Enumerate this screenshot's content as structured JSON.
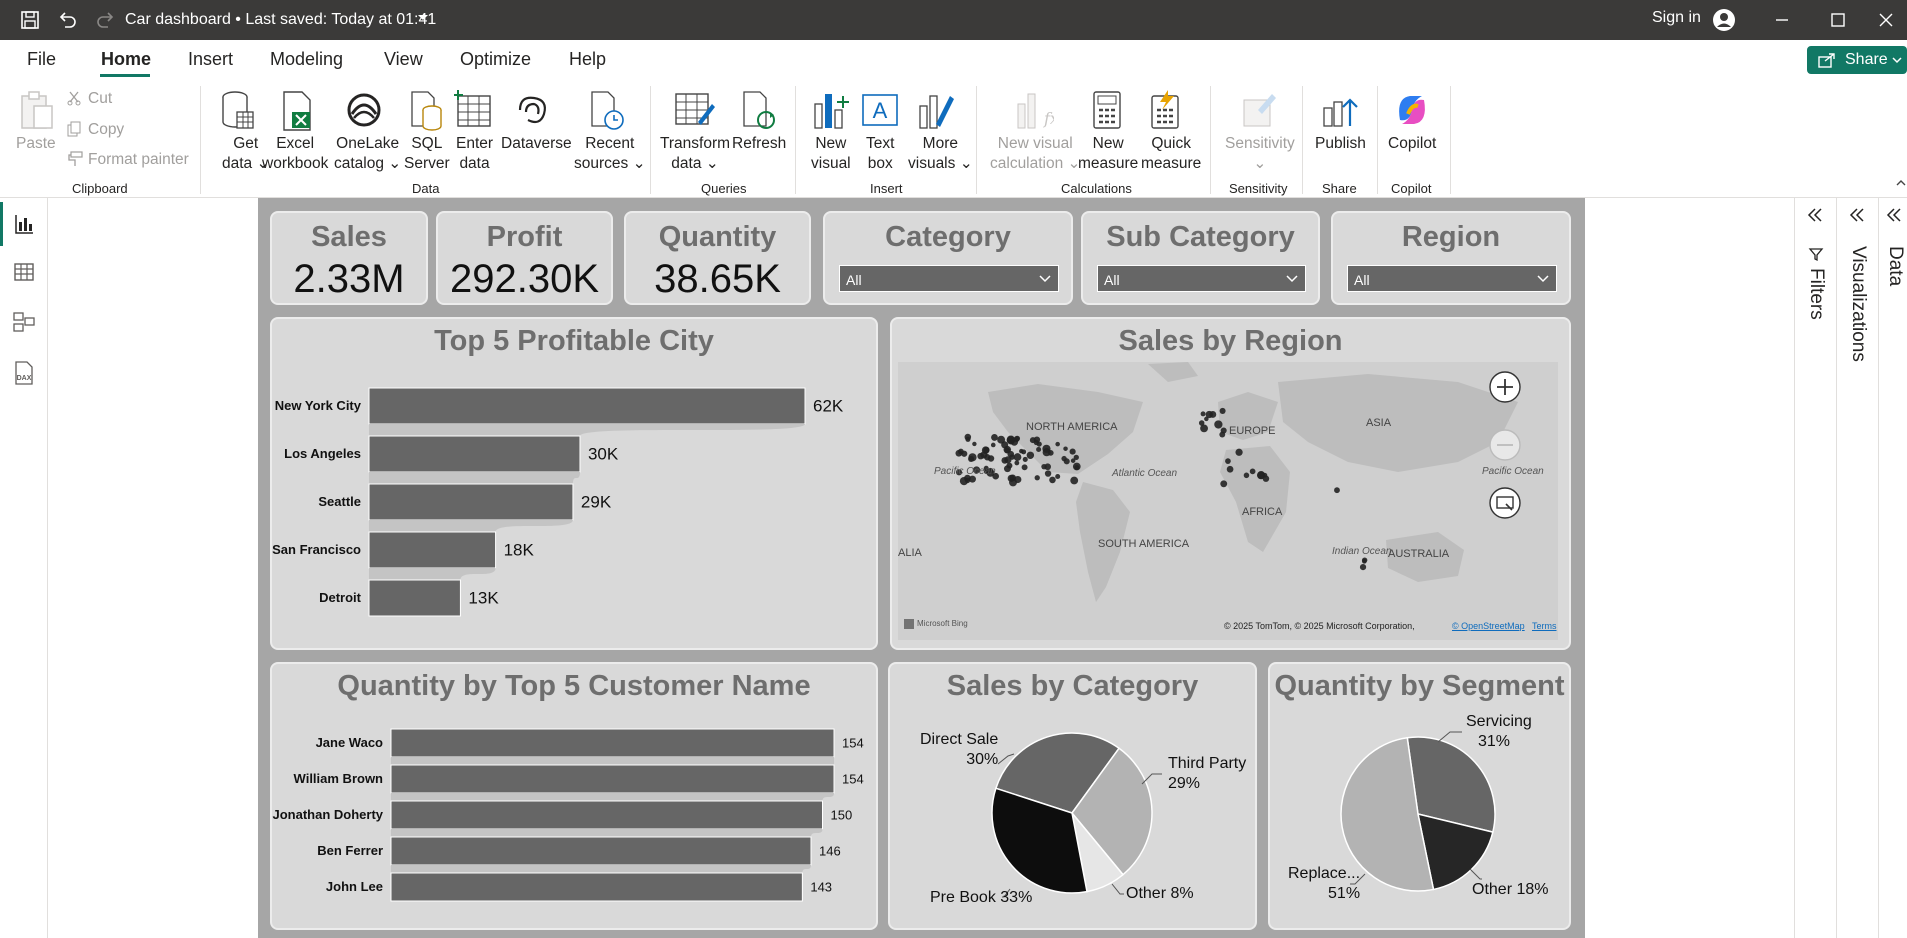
{
  "window": {
    "doc_title": "Car dashboard • Last saved: Today at 01:41",
    "sign_in": "Sign in"
  },
  "menu": {
    "file": "File",
    "home": "Home",
    "insert": "Insert",
    "modeling": "Modeling",
    "view": "View",
    "optimize": "Optimize",
    "help": "Help",
    "share": "Share"
  },
  "ribbon": {
    "paste": "Paste",
    "cut": "Cut",
    "copy": "Copy",
    "format_painter": "Format painter",
    "get_data_1": "Get",
    "get_data_2": "data",
    "excel_1": "Excel",
    "excel_2": "workbook",
    "onelake_1": "OneLake",
    "onelake_2": "catalog",
    "sql_1": "SQL",
    "sql_2": "Server",
    "enter_1": "Enter",
    "enter_2": "data",
    "dataverse": "Dataverse",
    "recent_1": "Recent",
    "recent_2": "sources",
    "transform_1": "Transform",
    "transform_2": "data",
    "refresh": "Refresh",
    "new_visual_1": "New",
    "new_visual_2": "visual",
    "text_box_1": "Text",
    "text_box_2": "box",
    "more_visuals_1": "More",
    "more_visuals_2": "visuals",
    "nvc_1": "New visual",
    "nvc_2": "calculation",
    "new_measure_1": "New",
    "new_measure_2": "measure",
    "quick_measure_1": "Quick",
    "quick_measure_2": "measure",
    "sensitivity": "Sensitivity",
    "publish": "Publish",
    "copilot": "Copilot",
    "groups": {
      "clipboard": "Clipboard",
      "data": "Data",
      "queries": "Queries",
      "insert": "Insert",
      "calculations": "Calculations",
      "sensitivity": "Sensitivity",
      "share": "Share",
      "copilot": "Copilot"
    }
  },
  "panes": {
    "filters": "Filters",
    "visualizations": "Visualizations",
    "data": "Data"
  },
  "kpis": [
    {
      "title": "Sales",
      "value": "2.33M"
    },
    {
      "title": "Profit",
      "value": "292.30K"
    },
    {
      "title": "Quantity",
      "value": "38.65K"
    }
  ],
  "slicers": [
    {
      "title": "Category",
      "value": "All"
    },
    {
      "title": "Sub Category",
      "value": "All"
    },
    {
      "title": "Region",
      "value": "All"
    }
  ],
  "map": {
    "title": "Sales by Region",
    "labels": {
      "north_america": "NORTH AMERICA",
      "europe": "EUROPE",
      "asia": "ASIA",
      "pacific_left": "Pacific Ocean",
      "pacific_right": "Pacific Ocean",
      "atlantic": "Atlantic Ocean",
      "africa": "AFRICA",
      "south_america": "SOUTH AMERICA",
      "alia": "ALIA",
      "indian": "Indian Ocean",
      "australia": "AUSTRALIA"
    },
    "attribution": "© 2025 TomTom, © 2025 Microsoft Corporation,",
    "osm": "© OpenStreetMap",
    "terms": "Terms",
    "bing": "Microsoft Bing"
  },
  "chart_data": [
    {
      "type": "bar",
      "title": "Top 5 Profitable City",
      "categories": [
        "New York City",
        "Los Angeles",
        "Seattle",
        "San Francisco",
        "Detroit"
      ],
      "values": [
        62,
        30,
        29,
        18,
        13
      ],
      "labels": [
        "62K",
        "30K",
        "29K",
        "18K",
        "13K"
      ],
      "orientation": "horizontal"
    },
    {
      "type": "bar",
      "title": "Quantity by Top 5 Customer Name",
      "categories": [
        "Jane Waco",
        "William Brown",
        "Jonathan Doherty",
        "Ben Ferrer",
        "John Lee"
      ],
      "values": [
        154,
        154,
        150,
        146,
        143
      ],
      "labels": [
        "154",
        "154",
        "150",
        "146",
        "143"
      ],
      "orientation": "horizontal"
    },
    {
      "type": "pie",
      "title": "Sales by Category",
      "slices": [
        {
          "name": "Direct Sale",
          "value": 30,
          "label": "30%",
          "color": "#666666"
        },
        {
          "name": "Third Party",
          "value": 29,
          "label": "29%",
          "color": "#b3b3b3"
        },
        {
          "name": "Other",
          "value": 8,
          "label": "8%",
          "color": "#e6e6e6"
        },
        {
          "name": "Pre Book",
          "value": 33,
          "label": "33%",
          "color": "#0d0d0d"
        }
      ]
    },
    {
      "type": "pie",
      "title": "Quantity by Segment",
      "slices": [
        {
          "name": "Servicing",
          "value": 31,
          "label": "31%",
          "color": "#666666"
        },
        {
          "name": "Other",
          "value": 18,
          "label": "18%",
          "color": "#262626"
        },
        {
          "name": "Replace...",
          "value": 51,
          "label": "51%",
          "color": "#b3b3b3"
        }
      ]
    }
  ]
}
